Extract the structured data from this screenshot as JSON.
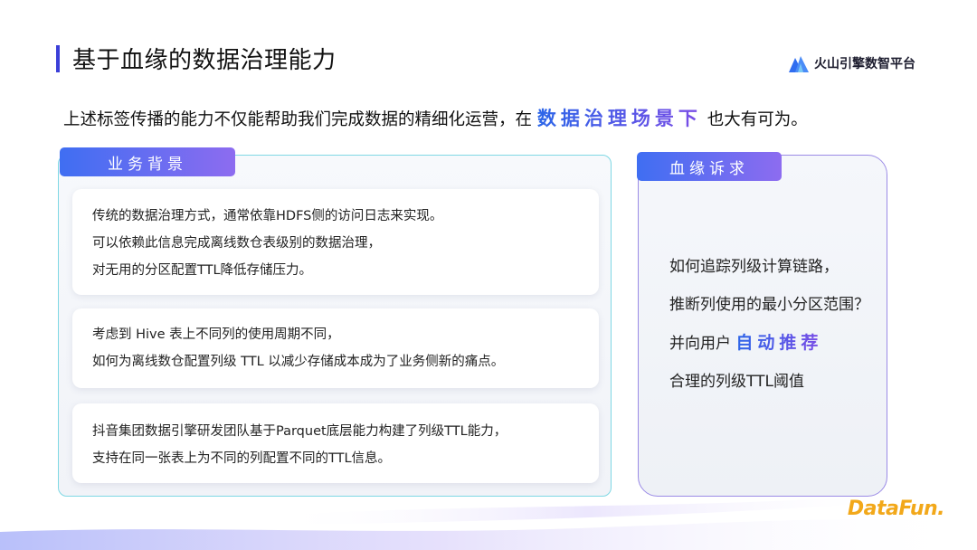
{
  "header": {
    "title": "基于血缘的数据治理能力",
    "brand": "火山引擎数智平台",
    "brand_logo_icon": "mountain-logo-icon",
    "accent_color": "#3b3fd8"
  },
  "intro": {
    "before": "上述标签传播的能力不仅能帮助我们完成数据的精细化运营，在",
    "highlight": "数据治理场景下",
    "after": "也大有可为。"
  },
  "left_panel": {
    "tag": "业务背景",
    "cards": [
      {
        "lines": [
          "传统的数据治理方式，通常依靠HDFS侧的访问日志来实现。",
          "可以依赖此信息完成离线数仓表级别的数据治理，",
          "对无用的分区配置TTL降低存储压力。"
        ]
      },
      {
        "lines": [
          "考虑到 Hive 表上不同列的使用周期不同，",
          "如何为离线数仓配置列级 TTL 以减少存储成本成为了业务侧新的痛点。"
        ]
      },
      {
        "lines": [
          "抖音集团数据引擎研发团队基于Parquet底层能力构建了列级TTL能力，",
          "支持在同一张表上为不同的列配置不同的TTL信息。"
        ]
      }
    ]
  },
  "right_panel": {
    "tag": "血缘诉求",
    "line1": "如何追踪列级计算链路，",
    "line2": "推断列使用的最小分区范围？",
    "line3_before": "并向用户",
    "line3_highlight": "自动推荐",
    "line4": "合理的列级TTL阈值"
  },
  "footer": {
    "logo": "DataFun.",
    "logo_color": "#f2a81a"
  }
}
